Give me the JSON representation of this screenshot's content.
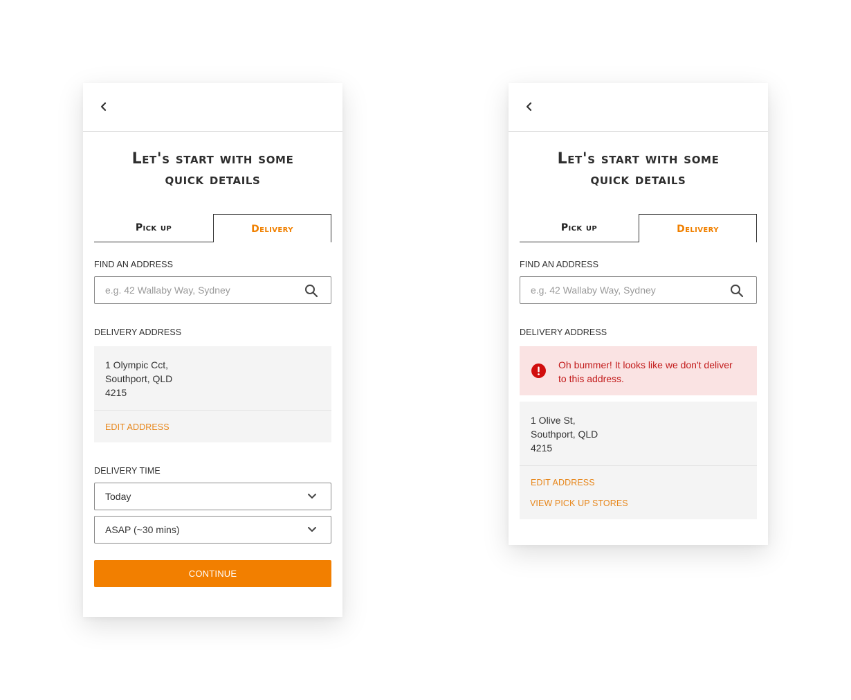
{
  "screens": [
    {
      "title_line1": "Let's start with some",
      "title_line2": "quick details",
      "tabs": [
        {
          "label": "Pick up",
          "active": false
        },
        {
          "label": "Delivery",
          "active": true
        }
      ],
      "find_address": {
        "label": "FIND AN ADDRESS",
        "placeholder": "e.g. 42 Wallaby Way, Sydney",
        "icon": "search-icon"
      },
      "delivery_address": {
        "label": "DELIVERY ADDRESS",
        "line1": "1 Olympic Cct,",
        "line2": "Southport, QLD",
        "line3": "4215",
        "edit_label": "EDIT ADDRESS"
      },
      "delivery_time": {
        "label": "DELIVERY TIME",
        "day_value": "Today",
        "time_value": "ASAP (~30 mins)"
      },
      "continue_label": "CONTINUE"
    },
    {
      "title_line1": "Let's start with some",
      "title_line2": "quick details",
      "tabs": [
        {
          "label": "Pick up",
          "active": false
        },
        {
          "label": "Delivery",
          "active": true
        }
      ],
      "find_address": {
        "label": "FIND AN ADDRESS",
        "placeholder": "e.g. 42 Wallaby Way, Sydney",
        "icon": "search-icon"
      },
      "delivery_address": {
        "label": "DELIVERY ADDRESS",
        "error_line1": "Oh bummer! It looks like we don't deliver",
        "error_line2": "to this address.",
        "line1": "1 Olive St,",
        "line2": "Southport, QLD",
        "line3": "4215",
        "edit_label": "EDIT ADDRESS",
        "view_stores_label": "VIEW PICK UP STORES"
      }
    }
  ],
  "colors": {
    "accent": "#f27f00",
    "link": "#e7861a",
    "error_text": "#c21a1a",
    "error_bg": "#fae3e3",
    "panel_bg": "#f4f4f4"
  }
}
